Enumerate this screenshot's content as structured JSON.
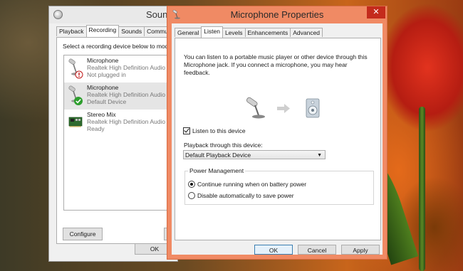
{
  "sound_window": {
    "title": "Sounc",
    "tabs": [
      "Playback",
      "Recording",
      "Sounds",
      "Communica"
    ],
    "active_tab": "Recording",
    "instruction": "Select a recording device below to modify",
    "devices": [
      {
        "name": "Microphone",
        "driver": "Realtek High Definition Audio",
        "status": "Not plugged in",
        "icon": "microphone-icon",
        "badge": "unplugged-badge-icon"
      },
      {
        "name": "Microphone",
        "driver": "Realtek High Definition Audio",
        "status": "Default Device",
        "icon": "microphone-icon",
        "badge": "default-checkmark-icon"
      },
      {
        "name": "Stereo Mix",
        "driver": "Realtek High Definition Audio",
        "status": "Ready",
        "icon": "sound-card-icon",
        "badge": ""
      }
    ],
    "configure_label": "Configure",
    "ok_label": "OK"
  },
  "mic_props": {
    "title": "Microphone Properties",
    "close_glyph": "✕",
    "tabs": [
      "General",
      "Listen",
      "Levels",
      "Enhancements",
      "Advanced"
    ],
    "active_tab": "Listen",
    "description": "You can listen to a portable music player or other device through this Microphone jack.  If you connect a microphone, you may hear feedback.",
    "listen_checkbox_label": "Listen to this device",
    "listen_checked": true,
    "playback_label": "Playback through this device:",
    "playback_selected": "Default Playback Device",
    "power_group_title": "Power Management",
    "radio_continue": "Continue running when on battery power",
    "radio_disable": "Disable automatically to save power",
    "radio_selected": "continue",
    "ok_label": "OK",
    "cancel_label": "Cancel",
    "apply_label": "Apply"
  },
  "colors": {
    "title_bar_accent": "#f08a64",
    "close_button": "#c42b1c",
    "default_check_green": "#2e9e2e",
    "unplugged_red": "#c01818"
  }
}
